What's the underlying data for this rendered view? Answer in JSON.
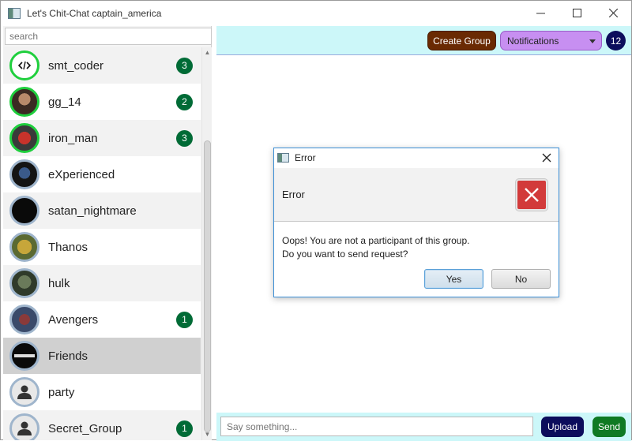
{
  "window": {
    "title": "Let's Chit-Chat captain_america",
    "app_icon": "app-window-icon",
    "controls": [
      "minimize-icon",
      "maximize-icon",
      "close-icon"
    ]
  },
  "sidebar": {
    "search_placeholder": "search",
    "items": [
      {
        "name": "smt_coder",
        "badge": "3",
        "online": true,
        "avatar": "code-avatar"
      },
      {
        "name": "gg_14",
        "badge": "2",
        "online": true,
        "avatar": "photo-avatar"
      },
      {
        "name": "iron_man",
        "badge": "3",
        "online": true,
        "avatar": "ironman-avatar"
      },
      {
        "name": "eXperienced",
        "badge": "",
        "online": false,
        "avatar": "hero-avatar"
      },
      {
        "name": "satan_nightmare",
        "badge": "",
        "online": false,
        "avatar": "dark-avatar"
      },
      {
        "name": "Thanos",
        "badge": "",
        "online": false,
        "avatar": "thanos-avatar"
      },
      {
        "name": "hulk",
        "badge": "",
        "online": false,
        "avatar": "hulk-avatar"
      },
      {
        "name": "Avengers",
        "badge": "1",
        "online": false,
        "avatar": "group-avatar"
      },
      {
        "name": "Friends",
        "badge": "",
        "online": false,
        "avatar": "friends-avatar",
        "selected": true
      },
      {
        "name": "party",
        "badge": "",
        "online": false,
        "avatar": "default-user-icon"
      },
      {
        "name": "Secret_Group",
        "badge": "1",
        "online": false,
        "avatar": "default-user-icon"
      }
    ]
  },
  "toolbar": {
    "create_group_label": "Create Group",
    "notifications_label": "Notifications",
    "notifications_count": "12"
  },
  "composer": {
    "placeholder": "Say something...",
    "upload_label": "Upload",
    "send_label": "Send"
  },
  "dialog": {
    "title": "Error",
    "header": "Error",
    "message_line1": "Oops! You are not a participant of this group.",
    "message_line2": "Do you want to send request?",
    "yes_label": "Yes",
    "no_label": "No"
  },
  "colors": {
    "online_ring": "#1fcf3d",
    "offline_ring": "#9fb5cc",
    "badge": "#006b36",
    "toolbar_bg": "#ccf7f9",
    "create_group": "#6a2a03",
    "notifications": "#c78ff1",
    "count_badge": "#0c0d5c",
    "upload": "#0c0d5c",
    "send": "#0f7a23",
    "error_icon": "#d23a3a"
  }
}
